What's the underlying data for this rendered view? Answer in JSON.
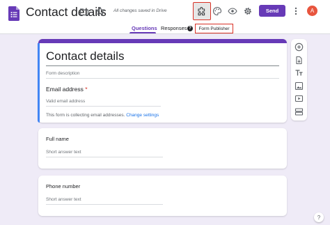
{
  "header": {
    "doc_title": "Contact details",
    "saved_status": "All changes saved in Drive",
    "send_label": "Send",
    "avatar_initial": "A",
    "tooltip": "Form Publisher",
    "icons": [
      "forms-logo-icon",
      "folder-icon",
      "star-icon",
      "addon-icon",
      "palette-icon",
      "eye-icon",
      "gear-icon",
      "more-vert-icon"
    ]
  },
  "tabs": [
    {
      "label": "Questions",
      "active": true
    },
    {
      "label": "Responses",
      "badge": "?"
    }
  ],
  "form": {
    "title": "Contact details",
    "description_placeholder": "Form description",
    "email": {
      "label": "Email address",
      "required_mark": "*",
      "placeholder": "Valid email address",
      "collecting_text": "This form is collecting email addresses.",
      "change_link": "Change settings"
    },
    "questions": [
      {
        "label": "Full name",
        "placeholder": "Short answer text"
      },
      {
        "label": "Phone number",
        "placeholder": "Short answer text"
      }
    ]
  },
  "side_toolbar": [
    "add-question-icon",
    "import-questions-icon",
    "add-title-icon",
    "add-image-icon",
    "add-video-icon",
    "add-section-icon"
  ],
  "help": "?",
  "colors": {
    "accent": "#673ab7",
    "highlight": "#d93025",
    "link": "#1a73e8",
    "avatar": "#e8553e",
    "background": "#efebf7"
  }
}
